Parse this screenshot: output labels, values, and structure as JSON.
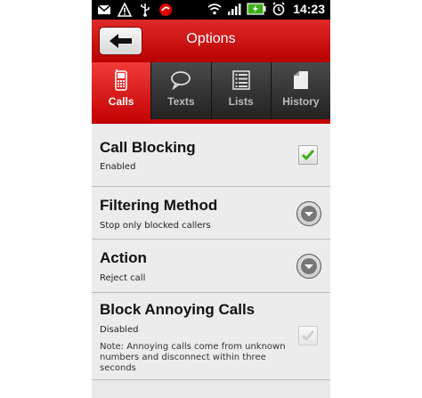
{
  "status_bar": {
    "time": "14:23",
    "icons": [
      "mail-icon",
      "warning-icon",
      "usb-icon",
      "app-notification-icon",
      "wifi-icon",
      "signal-icon",
      "battery-charging-icon",
      "alarm-icon"
    ]
  },
  "header": {
    "title": "Options",
    "back_icon": "back-arrow-icon"
  },
  "tabs": [
    {
      "label": "Calls",
      "icon": "phone-icon",
      "active": true
    },
    {
      "label": "Texts",
      "icon": "speech-bubble-icon",
      "active": false
    },
    {
      "label": "Lists",
      "icon": "list-icon",
      "active": false
    },
    {
      "label": "History",
      "icon": "document-icon",
      "active": false
    }
  ],
  "settings": [
    {
      "title": "Call Blocking",
      "summary": "Enabled",
      "control": "checkbox",
      "checked": true,
      "enabled": true
    },
    {
      "title": "Filtering Method",
      "summary": "Stop only blocked callers",
      "control": "dropdown"
    },
    {
      "title": "Action",
      "summary": "Reject call",
      "control": "dropdown"
    },
    {
      "title": "Block Annoying Calls",
      "summary": "Disabled",
      "note": "Note: Annoying calls come from unknown numbers and disconnect within three seconds",
      "control": "checkbox",
      "checked": true,
      "enabled": false
    }
  ],
  "colors": {
    "accent": "#cc0000",
    "check": "#3fae1a",
    "check_disabled": "#d0d0d0"
  }
}
